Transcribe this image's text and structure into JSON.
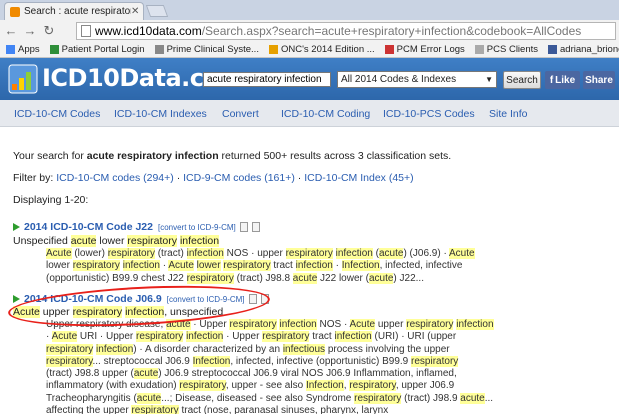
{
  "browser": {
    "tab_title": "Search : acute respiratory",
    "url_host": "www.icd10data.com",
    "url_path": "/Search.aspx?search=acute+respiratory+infection&codebook=AllCodes",
    "bookmarks": [
      "Apps",
      "Patient Portal Login",
      "Prime Clinical Syste...",
      "ONC's 2014 Edition ...",
      "PCM Error Logs",
      "PCS Clients",
      "adriana_briones | Scr..."
    ]
  },
  "header": {
    "logo": "ICD10Data.com",
    "search_value": "acute respiratory infection",
    "scope": "All 2014 Codes & Indexes",
    "search_button": "Search",
    "like_button": "Like",
    "share_button": "Share"
  },
  "nav": [
    "ICD-10-CM Codes",
    "ICD-10-CM Indexes",
    "Convert",
    "ICD-10-CM Coding",
    "ICD-10-PCS Codes",
    "Site Info"
  ],
  "summary": {
    "prefix": "Your search for ",
    "term": "acute respiratory infection",
    "suffix": " returned 500+ results across 3 classification sets."
  },
  "filter": {
    "label": "Filter by: ",
    "options": [
      "ICD-10-CM codes (294+)",
      "ICD-9-CM codes (161+)",
      "ICD-10-CM Index (45+)"
    ],
    "separator": " · "
  },
  "displaying": "Displaying 1-20:",
  "results": [
    {
      "title": "2014 ICD-10-CM Code J22",
      "convert": "[convert to ICD-9-CM]",
      "description": [
        [
          "Unspecified ",
          false
        ],
        [
          "acute",
          true
        ],
        [
          " lower ",
          false
        ],
        [
          "respiratory",
          true
        ],
        [
          " ",
          false
        ],
        [
          "infection",
          true
        ]
      ],
      "snippet": [
        [
          [
            "Acute",
            true
          ],
          [
            " (lower) ",
            false
          ],
          [
            "respiratory",
            true
          ],
          [
            " (tract) ",
            false
          ],
          [
            "infection",
            true
          ],
          [
            " NOS · upper ",
            false
          ],
          [
            "respiratory",
            true
          ],
          [
            " ",
            false
          ],
          [
            "infection",
            true
          ],
          [
            " (",
            false
          ],
          [
            "acute",
            true
          ],
          [
            ") (J06.9) · ",
            false
          ],
          [
            "Acute",
            true
          ]
        ],
        [
          [
            "lower ",
            false
          ],
          [
            "respiratory",
            true
          ],
          [
            " ",
            false
          ],
          [
            "infection",
            true
          ],
          [
            " · ",
            false
          ],
          [
            "Acute",
            true
          ],
          [
            " ",
            false
          ],
          [
            "lower",
            true
          ],
          [
            " ",
            false
          ],
          [
            "respiratory",
            true
          ],
          [
            " tract ",
            false
          ],
          [
            "infection",
            true
          ],
          [
            " · ",
            false
          ],
          [
            "Infection",
            true
          ],
          [
            ", infected, infective",
            false
          ]
        ],
        [
          [
            "(opportunistic) B99.9 chest J22 ",
            false
          ],
          [
            "respiratory",
            true
          ],
          [
            " (tract) J98.8 ",
            false
          ],
          [
            "acute",
            true
          ],
          [
            " J22 lower (",
            false
          ],
          [
            "acute",
            true
          ],
          [
            ") J22...",
            false
          ]
        ]
      ]
    },
    {
      "title": "2014 ICD-10-CM Code J06.9",
      "convert": "[convert to ICD-9-CM]",
      "description": [
        [
          "Acute",
          true
        ],
        [
          " upper ",
          false
        ],
        [
          "respiratory",
          true
        ],
        [
          " ",
          false
        ],
        [
          "infection",
          true
        ],
        [
          ", unspecified",
          false
        ]
      ],
      "snippet": [
        [
          [
            "Upper respiratory disease, ",
            false
          ],
          [
            "acute",
            true
          ],
          [
            " · Upper ",
            false
          ],
          [
            "respiratory",
            true
          ],
          [
            " ",
            false
          ],
          [
            "infection",
            true
          ],
          [
            " NOS · ",
            false
          ],
          [
            "Acute",
            true
          ],
          [
            " upper ",
            false
          ],
          [
            "respiratory",
            true
          ],
          [
            " ",
            false
          ],
          [
            "infection",
            true
          ]
        ],
        [
          [
            "· ",
            false
          ],
          [
            "Acute",
            true
          ],
          [
            " URI · Upper ",
            false
          ],
          [
            "respiratory",
            true
          ],
          [
            " ",
            false
          ],
          [
            "infection",
            true
          ],
          [
            " · Upper ",
            false
          ],
          [
            "respiratory",
            true
          ],
          [
            " tract ",
            false
          ],
          [
            "infection",
            true
          ],
          [
            " (URI) · URI (upper",
            false
          ]
        ],
        [
          [
            "respiratory",
            true
          ],
          [
            " ",
            false
          ],
          [
            "infection",
            true
          ],
          [
            ") · A disorder characterized by an ",
            false
          ],
          [
            "infectious",
            true
          ],
          [
            " process involving the upper",
            false
          ]
        ],
        [
          [
            "respiratory",
            true
          ],
          [
            "... streptococcal J06.9 ",
            false
          ],
          [
            "Infection",
            true
          ],
          [
            ", infected, infective (opportunistic) B99.9 ",
            false
          ],
          [
            "respiratory",
            true
          ]
        ],
        [
          [
            "(tract) J98.8 upper (",
            false
          ],
          [
            "acute",
            true
          ],
          [
            ") J06.9 streptococcal J06.9 viral NOS J06.9 Inflammation, inflamed,",
            false
          ]
        ],
        [
          [
            "inflammatory (with exudation) ",
            false
          ],
          [
            "respiratory",
            true
          ],
          [
            ", upper - see also ",
            false
          ],
          [
            "Infection",
            true
          ],
          [
            ", ",
            false
          ],
          [
            "respiratory",
            true
          ],
          [
            ", upper J06.9",
            false
          ]
        ],
        [
          [
            "Tracheopharyngitis (",
            false
          ],
          [
            "acute",
            true
          ],
          [
            "...; Disease, diseased - see also Syndrome ",
            false
          ],
          [
            "respiratory",
            true
          ],
          [
            " (tract) J98.9 ",
            false
          ],
          [
            "acute",
            true
          ],
          [
            "...",
            false
          ]
        ],
        [
          [
            "affecting the upper ",
            false
          ],
          [
            "respiratory",
            true
          ],
          [
            " tract (nose, paranasal sinuses, pharynx, larynx",
            false
          ]
        ]
      ]
    }
  ]
}
